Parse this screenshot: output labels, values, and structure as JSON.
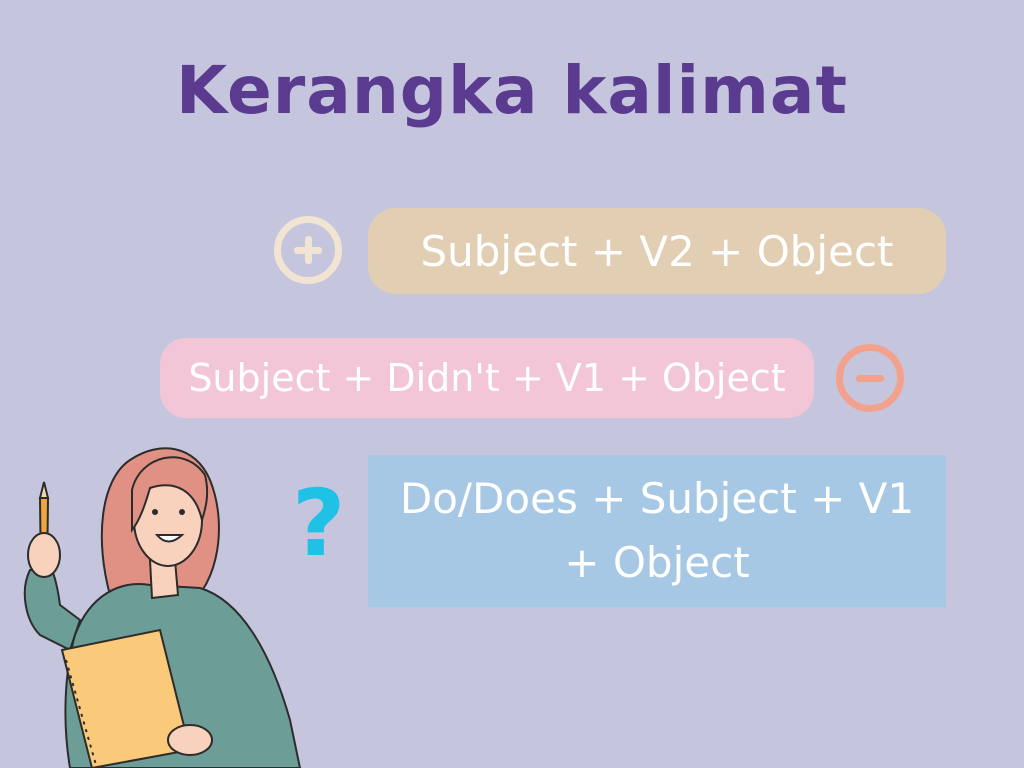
{
  "title": "Kerangka kalimat",
  "formulas": {
    "positive": "Subject + V2 + Object",
    "negative": "Subject + Didn't + V1 + Object",
    "question": "Do/Does + Subject + V1 + Object"
  },
  "icons": {
    "positive": "plus-circle-icon",
    "negative": "minus-circle-icon",
    "question": "question-mark-icon"
  },
  "colors": {
    "background": "#c5c6dd",
    "title": "#5b3b8f",
    "positive_pill": "#e2cfb3",
    "negative_pill": "#f2c5d7",
    "question_box": "#a6c8e5",
    "question_mark": "#1fc2e4"
  }
}
